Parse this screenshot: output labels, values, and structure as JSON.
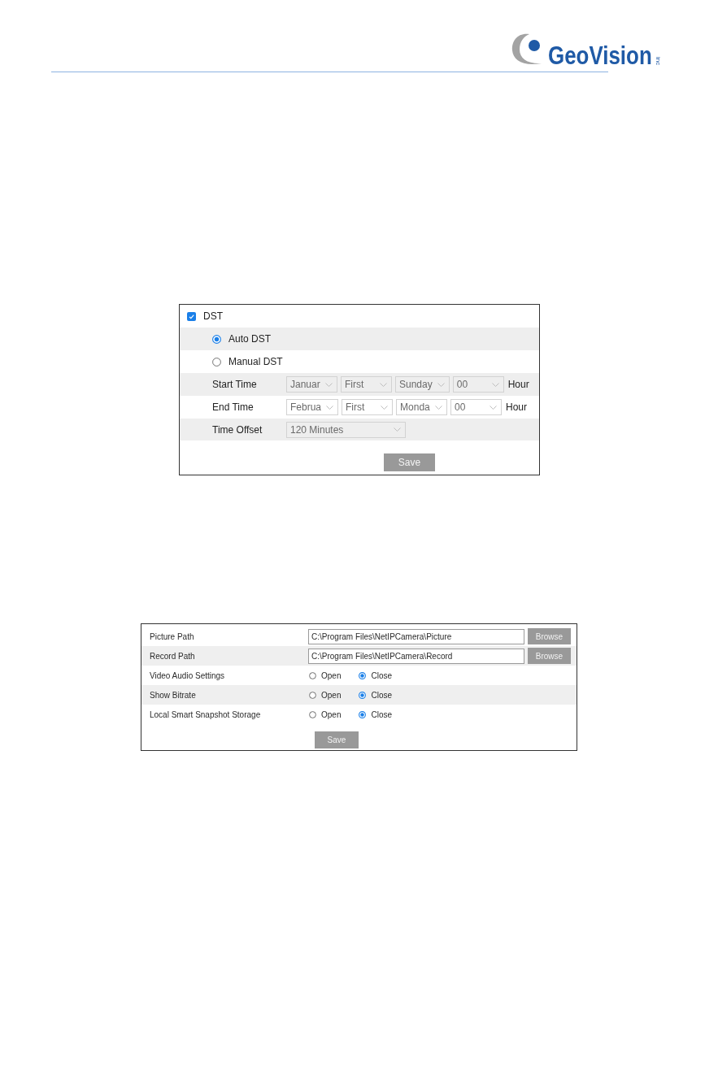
{
  "header": {
    "logo": {
      "name": "GeoVision",
      "suffix": "inc"
    }
  },
  "dst_settings": {
    "dst": {
      "label": "DST",
      "checked": true
    },
    "modes": [
      {
        "label": "Auto DST",
        "selected": true
      },
      {
        "label": "Manual DST",
        "selected": false
      }
    ],
    "schedule": [
      {
        "label": "Start Time",
        "month": "Januar",
        "week": "First",
        "day": "Sunday",
        "hour": "00",
        "unit": "Hour"
      },
      {
        "label": "End Time",
        "month": "Februa",
        "week": "First",
        "day": "Monda",
        "hour": "00",
        "unit": "Hour"
      }
    ],
    "time_offset": {
      "label": "Time Offset",
      "value": "120 Minutes"
    },
    "save_button": "Save"
  },
  "local_settings": {
    "paths": [
      {
        "label": "Picture Path",
        "value": "C:\\Program Files\\NetIPCamera\\Picture",
        "button": "Browse"
      },
      {
        "label": "Record Path",
        "value": "C:\\Program Files\\NetIPCamera\\Record",
        "button": "Browse"
      }
    ],
    "options": [
      {
        "label": "Video Audio Settings",
        "choices": [
          {
            "label": "Open",
            "selected": false
          },
          {
            "label": "Close",
            "selected": true
          }
        ]
      },
      {
        "label": "Show Bitrate",
        "choices": [
          {
            "label": "Open",
            "selected": false
          },
          {
            "label": "Close",
            "selected": true
          }
        ]
      },
      {
        "label": "Local Smart Snapshot Storage",
        "choices": [
          {
            "label": "Open",
            "selected": false
          },
          {
            "label": "Close",
            "selected": true
          }
        ]
      }
    ],
    "save_button": "Save"
  }
}
